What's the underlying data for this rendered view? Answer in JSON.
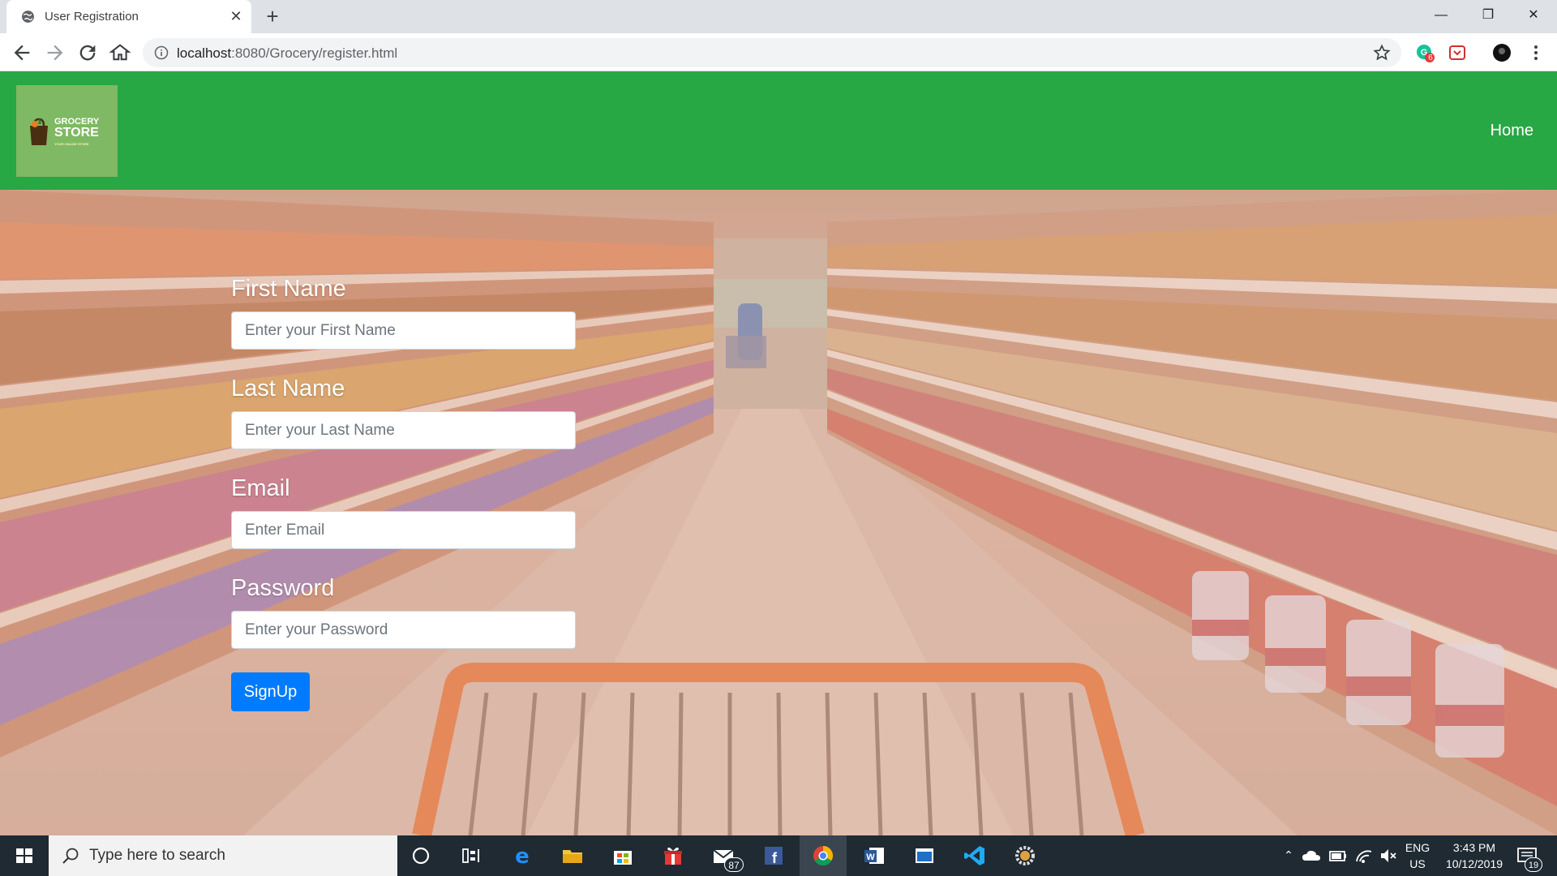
{
  "browser": {
    "tab_title": "User Registration",
    "url_host": "localhost",
    "url_rest": ":8080/Grocery/register.html",
    "ext_badge": "6"
  },
  "navbar": {
    "logo_line1": "GROCERY",
    "logo_line2": "STORE",
    "logo_line3": "YOUR ONLINE STORE",
    "home_label": "Home"
  },
  "form": {
    "first_name_label": "First Name",
    "first_name_placeholder": "Enter your First Name",
    "last_name_label": "Last Name",
    "last_name_placeholder": "Enter your Last Name",
    "email_label": "Email",
    "email_placeholder": "Enter Email",
    "password_label": "Password",
    "password_placeholder": "Enter your Password",
    "signup_label": "SignUp"
  },
  "taskbar": {
    "search_placeholder": "Type here to search",
    "mail_badge": "87",
    "lang": "ENG",
    "region": "US",
    "time": "3:43 PM",
    "date": "10/12/2019",
    "notifications": "19"
  },
  "colors": {
    "navbar": "#28a745",
    "signup_button": "#007bff"
  }
}
